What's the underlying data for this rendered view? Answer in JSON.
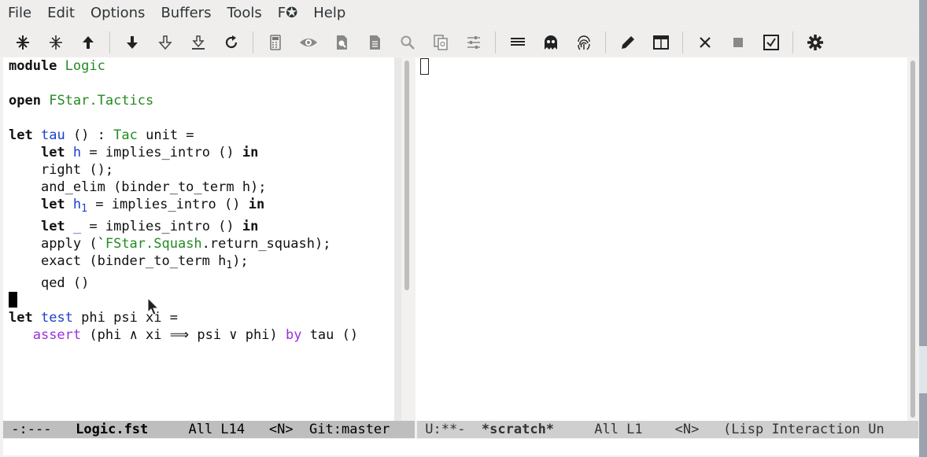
{
  "menubar": {
    "items": [
      "File",
      "Edit",
      "Options",
      "Buffers",
      "Tools",
      "F✪",
      "Help"
    ]
  },
  "toolbar": {
    "icons": [
      "skip-to-bottom-icon",
      "collapse-icon",
      "arrow-up-icon",
      "arrow-down-icon",
      "arrow-down-outline-icon",
      "arrow-to-bottom-icon",
      "reload-icon",
      "calculator-icon",
      "eye-icon",
      "zoom-page-icon",
      "document-icon",
      "magnify-icon",
      "copy-icon",
      "sliders-icon",
      "list-icon",
      "ghost-icon",
      "fingerprint-icon",
      "pencil-icon",
      "window-icon",
      "close-icon",
      "stop-icon",
      "checkbox-icon",
      "gear-icon"
    ]
  },
  "editor": {
    "lines": {
      "l1_kw": "module",
      "l1_name": "Logic",
      "l3_kw": "open",
      "l3_name": "FStar.Tactics",
      "l5_kw": "let",
      "l5_name": "tau",
      "l5_mid": "() :",
      "l5_type": "Tac",
      "l5_rest": "unit =",
      "l6_kw": "let",
      "l6_name": "h",
      "l6_rest": "= implies_intro ()",
      "l6_in": "in",
      "l7": "right ();",
      "l8": "and_elim (binder_to_term h);",
      "l9_kw": "let",
      "l9_name": "h",
      "l9_sub": "1",
      "l9_rest": "= implies_intro ()",
      "l9_in": "in",
      "l10_kw": "let",
      "l10_name": "_",
      "l10_rest": " = implies_intro ()",
      "l10_in": "in",
      "l11_a": "apply (`",
      "l11_mod": "FStar.Squash",
      "l11_b": ".return_squash);",
      "l12_a": "exact (binder_to_term h",
      "l12_sub": "1",
      "l12_b": ");",
      "l13": "qed ()",
      "l15_kw": "let",
      "l15_name": "test",
      "l15_rest": "phi psi xi =",
      "l16_kw": "assert",
      "l16_mid": "(phi ∧ xi ⟹ psi ∨ phi)",
      "l16_by": "by",
      "l16_rest": "tau ()"
    }
  },
  "modeline_left": {
    "status": "-:---",
    "buffer": "Logic.fst",
    "position": "All L14",
    "mode": "<N>",
    "git": "Git:master"
  },
  "modeline_right": {
    "status": "U:**-",
    "buffer": "*scratch*",
    "position": "All L1",
    "mode": "<N>",
    "major": "(Lisp Interaction Un"
  },
  "colors": {
    "keyword": "#111111",
    "module_name": "#228b22",
    "identifier": "#1a3fcc",
    "assert_kw": "#9b30d9"
  }
}
